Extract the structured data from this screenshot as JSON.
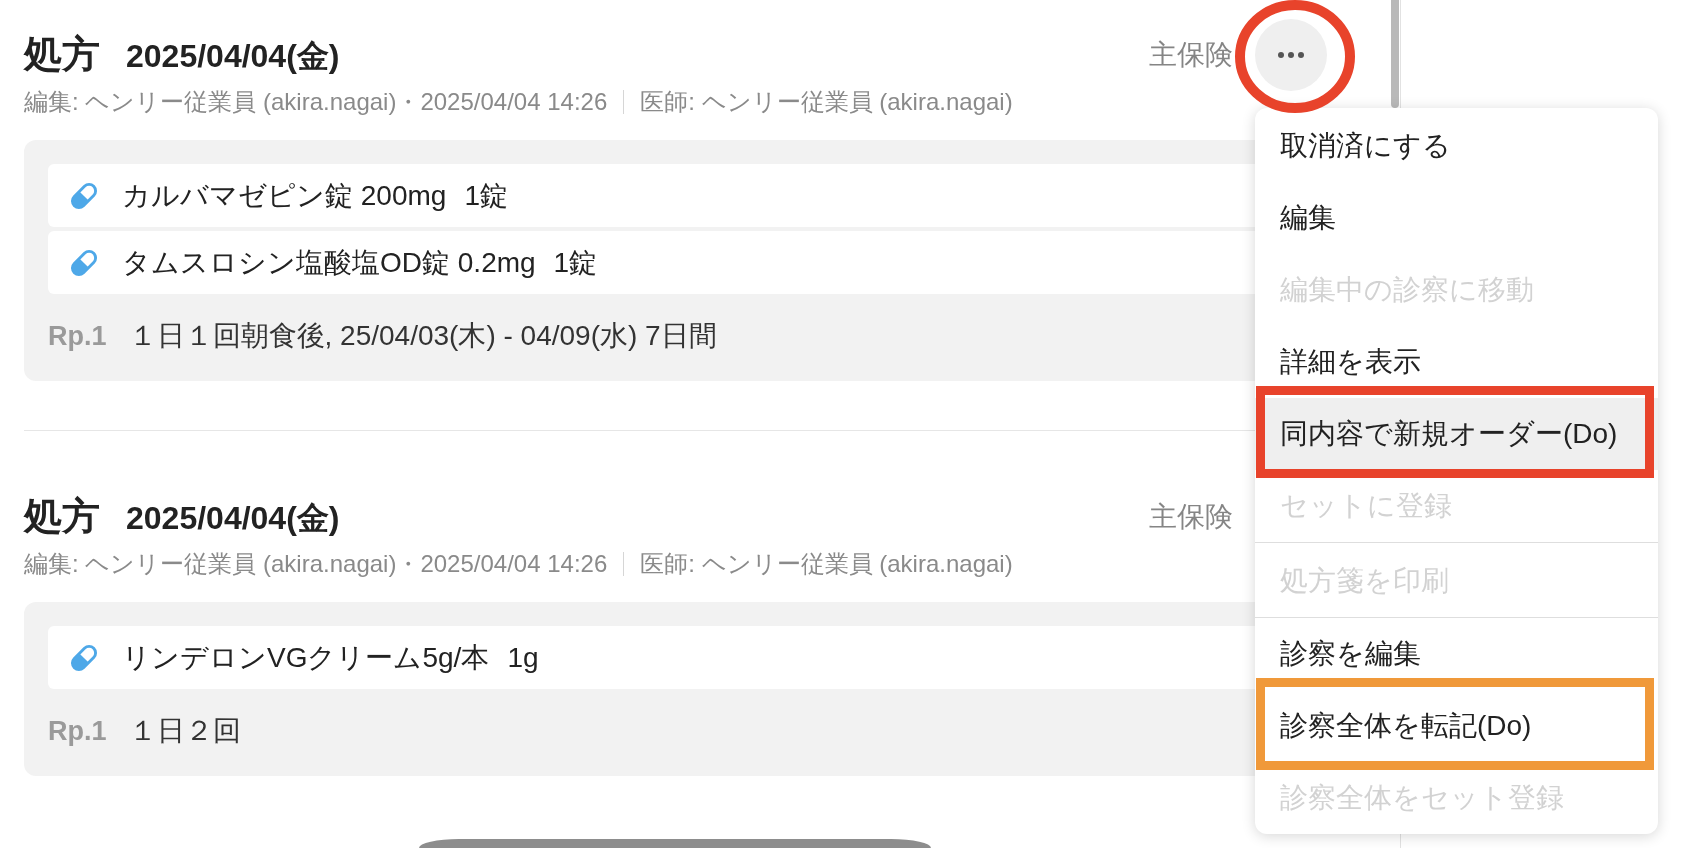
{
  "records": [
    {
      "title": "処方",
      "date": "2025/04/04(金)",
      "editor": "編集: ヘンリー従業員 (akira.nagai)・2025/04/04 14:26",
      "doctor": "医師: ヘンリー従業員 (akira.nagai)",
      "insurance": "主保険",
      "more_button": {
        "annotation": {
          "color": "#e8432b"
        }
      },
      "medications": [
        {
          "name": "カルバマゼピン錠 200mg",
          "quantity": "1錠"
        },
        {
          "name": "タムスロシン塩酸塩OD錠 0.2mg",
          "quantity": "1錠"
        }
      ],
      "rp": {
        "label": "Rp.1",
        "usage": "１日１回朝食後, 25/04/03(木) - 04/09(水) 7日間"
      }
    },
    {
      "title": "処方",
      "date": "2025/04/04(金)",
      "editor": "編集: ヘンリー従業員 (akira.nagai)・2025/04/04 14:26",
      "doctor": "医師: ヘンリー従業員 (akira.nagai)",
      "insurance": "主保険",
      "medications": [
        {
          "name": "リンデロンVGクリーム5g/本",
          "quantity": "1g"
        }
      ],
      "rp": {
        "label": "Rp.1",
        "usage": "１日２回"
      }
    }
  ],
  "menu": {
    "sections": [
      {
        "items": [
          {
            "label": "取消済にする",
            "disabled": false,
            "highlighted": false
          },
          {
            "label": "編集",
            "disabled": false,
            "highlighted": false
          },
          {
            "label": "編集中の診察に移動",
            "disabled": true,
            "highlighted": false
          },
          {
            "label": "詳細を表示",
            "disabled": false,
            "highlighted": false
          },
          {
            "label": "同内容で新規オーダー(Do)",
            "disabled": false,
            "highlighted": true,
            "annotation": {
              "color": "#e8432b"
            }
          },
          {
            "label": "セットに登録",
            "disabled": true,
            "highlighted": false
          }
        ]
      },
      {
        "items": [
          {
            "label": "処方箋を印刷",
            "disabled": true,
            "highlighted": false
          }
        ]
      },
      {
        "items": [
          {
            "label": "診察を編集",
            "disabled": false,
            "highlighted": false
          },
          {
            "label": "診察全体を転記(Do)",
            "disabled": false,
            "highlighted": false,
            "annotation": {
              "color": "#f0993a"
            }
          },
          {
            "label": "診察全体をセット登録",
            "disabled": true,
            "highlighted": false
          }
        ]
      }
    ]
  }
}
